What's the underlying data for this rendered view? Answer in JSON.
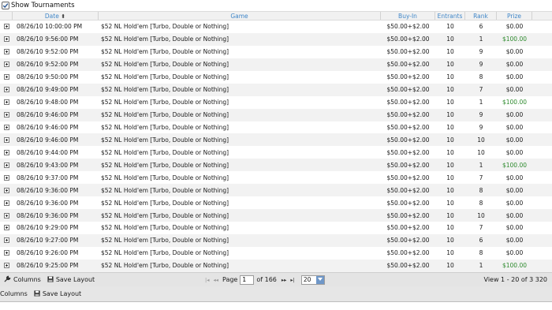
{
  "top": {
    "show_tournaments": "Show Tournaments"
  },
  "header": {
    "date": "Date",
    "game": "Game",
    "buyin": "Buy-In",
    "entrants": "Entrants",
    "rank": "Rank",
    "prize": "Prize"
  },
  "rows": [
    {
      "date": "08/26/10 10:00:00 PM",
      "game": "$52 NL Hold'em [Turbo, Double or Nothing]",
      "buyin": "$50.00+$2.00",
      "entrants": "10",
      "rank": "6",
      "prize": "$0.00",
      "win": false
    },
    {
      "date": "08/26/10 9:56:00 PM",
      "game": "$52 NL Hold'em [Turbo, Double or Nothing]",
      "buyin": "$50.00+$2.00",
      "entrants": "10",
      "rank": "1",
      "prize": "$100.00",
      "win": true
    },
    {
      "date": "08/26/10 9:52:00 PM",
      "game": "$52 NL Hold'em [Turbo, Double or Nothing]",
      "buyin": "$50.00+$2.00",
      "entrants": "10",
      "rank": "9",
      "prize": "$0.00",
      "win": false
    },
    {
      "date": "08/26/10 9:52:00 PM",
      "game": "$52 NL Hold'em [Turbo, Double or Nothing]",
      "buyin": "$50.00+$2.00",
      "entrants": "10",
      "rank": "9",
      "prize": "$0.00",
      "win": false
    },
    {
      "date": "08/26/10 9:50:00 PM",
      "game": "$52 NL Hold'em [Turbo, Double or Nothing]",
      "buyin": "$50.00+$2.00",
      "entrants": "10",
      "rank": "8",
      "prize": "$0.00",
      "win": false
    },
    {
      "date": "08/26/10 9:49:00 PM",
      "game": "$52 NL Hold'em [Turbo, Double or Nothing]",
      "buyin": "$50.00+$2.00",
      "entrants": "10",
      "rank": "7",
      "prize": "$0.00",
      "win": false
    },
    {
      "date": "08/26/10 9:48:00 PM",
      "game": "$52 NL Hold'em [Turbo, Double or Nothing]",
      "buyin": "$50.00+$2.00",
      "entrants": "10",
      "rank": "1",
      "prize": "$100.00",
      "win": true
    },
    {
      "date": "08/26/10 9:46:00 PM",
      "game": "$52 NL Hold'em [Turbo, Double or Nothing]",
      "buyin": "$50.00+$2.00",
      "entrants": "10",
      "rank": "9",
      "prize": "$0.00",
      "win": false
    },
    {
      "date": "08/26/10 9:46:00 PM",
      "game": "$52 NL Hold'em [Turbo, Double or Nothing]",
      "buyin": "$50.00+$2.00",
      "entrants": "10",
      "rank": "9",
      "prize": "$0.00",
      "win": false
    },
    {
      "date": "08/26/10 9:46:00 PM",
      "game": "$52 NL Hold'em [Turbo, Double or Nothing]",
      "buyin": "$50.00+$2.00",
      "entrants": "10",
      "rank": "10",
      "prize": "$0.00",
      "win": false
    },
    {
      "date": "08/26/10 9:44:00 PM",
      "game": "$52 NL Hold'em [Turbo, Double or Nothing]",
      "buyin": "$50.00+$2.00",
      "entrants": "10",
      "rank": "10",
      "prize": "$0.00",
      "win": false
    },
    {
      "date": "08/26/10 9:43:00 PM",
      "game": "$52 NL Hold'em [Turbo, Double or Nothing]",
      "buyin": "$50.00+$2.00",
      "entrants": "10",
      "rank": "1",
      "prize": "$100.00",
      "win": true
    },
    {
      "date": "08/26/10 9:37:00 PM",
      "game": "$52 NL Hold'em [Turbo, Double or Nothing]",
      "buyin": "$50.00+$2.00",
      "entrants": "10",
      "rank": "7",
      "prize": "$0.00",
      "win": false
    },
    {
      "date": "08/26/10 9:36:00 PM",
      "game": "$52 NL Hold'em [Turbo, Double or Nothing]",
      "buyin": "$50.00+$2.00",
      "entrants": "10",
      "rank": "8",
      "prize": "$0.00",
      "win": false
    },
    {
      "date": "08/26/10 9:36:00 PM",
      "game": "$52 NL Hold'em [Turbo, Double or Nothing]",
      "buyin": "$50.00+$2.00",
      "entrants": "10",
      "rank": "8",
      "prize": "$0.00",
      "win": false
    },
    {
      "date": "08/26/10 9:36:00 PM",
      "game": "$52 NL Hold'em [Turbo, Double or Nothing]",
      "buyin": "$50.00+$2.00",
      "entrants": "10",
      "rank": "10",
      "prize": "$0.00",
      "win": false
    },
    {
      "date": "08/26/10 9:29:00 PM",
      "game": "$52 NL Hold'em [Turbo, Double or Nothing]",
      "buyin": "$50.00+$2.00",
      "entrants": "10",
      "rank": "7",
      "prize": "$0.00",
      "win": false
    },
    {
      "date": "08/26/10 9:27:00 PM",
      "game": "$52 NL Hold'em [Turbo, Double or Nothing]",
      "buyin": "$50.00+$2.00",
      "entrants": "10",
      "rank": "6",
      "prize": "$0.00",
      "win": false
    },
    {
      "date": "08/26/10 9:26:00 PM",
      "game": "$52 NL Hold'em [Turbo, Double or Nothing]",
      "buyin": "$50.00+$2.00",
      "entrants": "10",
      "rank": "8",
      "prize": "$0.00",
      "win": false
    },
    {
      "date": "08/26/10 9:25:00 PM",
      "game": "$52 NL Hold'em [Turbo, Double or Nothing]",
      "buyin": "$50.00+$2.00",
      "entrants": "10",
      "rank": "1",
      "prize": "$100.00",
      "win": true
    }
  ],
  "pager": {
    "columns": "Columns",
    "save_layout": "Save Layout",
    "page_label": "Page",
    "page_value": "1",
    "of_pages": "of 166",
    "rows_per_page": "20",
    "view_info": "View 1 - 20 of 3 320"
  },
  "footer": {
    "columns": "Columns",
    "save_layout": "Save Layout"
  },
  "colors": {
    "header_text": "#3f86c8",
    "win_prize": "#2e8b2e",
    "alt_row": "#f2f2f2"
  }
}
